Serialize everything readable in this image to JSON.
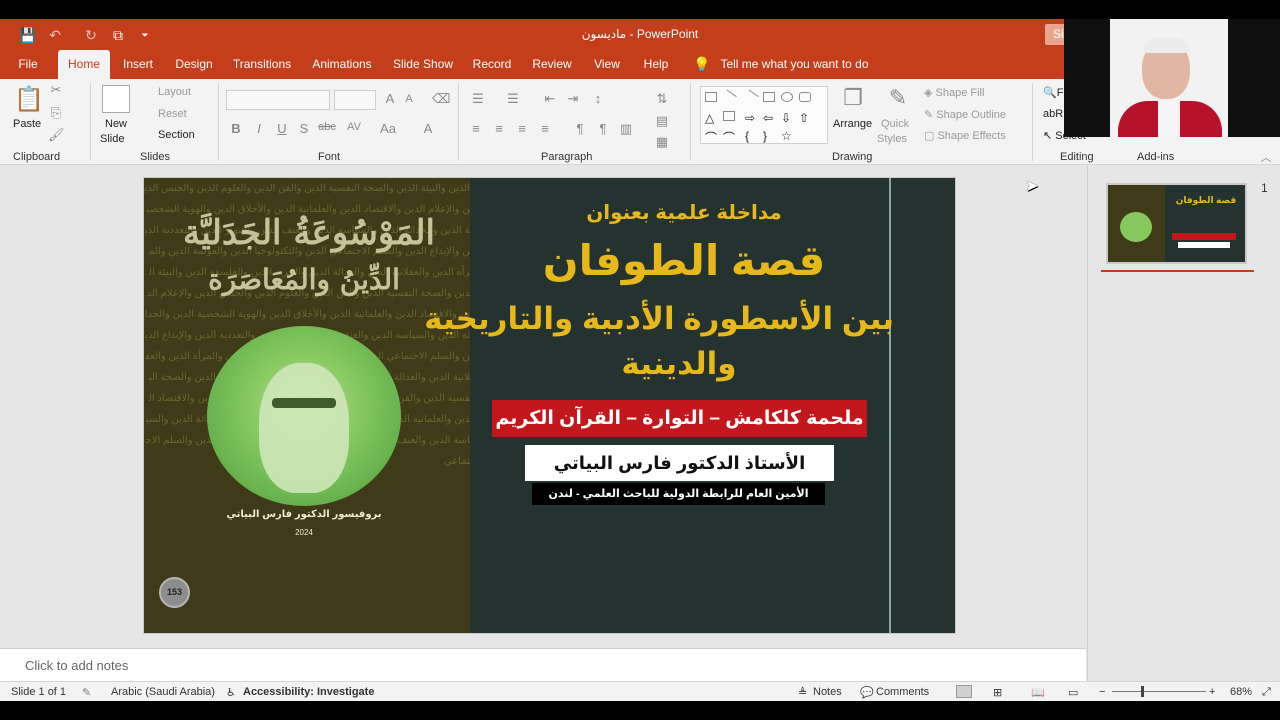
{
  "window": {
    "title": "ماديسون  -  PowerPoint",
    "signin_label": "Sig"
  },
  "qat": {
    "save": "💾",
    "undo": "↶",
    "redo": "↻",
    "present": "⧉",
    "more": "⏷"
  },
  "tabs": [
    "File",
    "Home",
    "Insert",
    "Design",
    "Transitions",
    "Animations",
    "Slide Show",
    "Record",
    "Review",
    "View",
    "Help"
  ],
  "tellme": {
    "label": "Tell me what you want to do"
  },
  "ribbon": {
    "clipboard": {
      "label": "Clipboard",
      "paste": "Paste"
    },
    "slides": {
      "label": "Slides",
      "new_slide_1": "New",
      "new_slide_2": "Slide",
      "layout": "Layout",
      "reset": "Reset",
      "section": "Section"
    },
    "font": {
      "label": "Font",
      "bold": "B",
      "italic": "I",
      "underline": "U",
      "shadow": "S",
      "strike": "abc"
    },
    "paragraph": {
      "label": "Paragraph"
    },
    "drawing": {
      "label": "Drawing",
      "arrange": "Arrange",
      "quick_styles_1": "Quick",
      "quick_styles_2": "Styles",
      "shape_fill": "Shape Fill",
      "shape_outline": "Shape Outline",
      "shape_effects": "Shape Effects"
    },
    "editing": {
      "label": "Editing",
      "find": "F",
      "replace": "R",
      "select": "Select"
    },
    "addins": {
      "label": "Add-ins"
    }
  },
  "slide": {
    "bg_text": "الدين والبيئة الدين والصحة النفسية الدين والفن الدين والعلوم الدين والجنس الدين والإعلام الدين والاقتصاد الدين والعلمانية الدين والأخلاق الدين والهوية الشخصية الدين والحداثة الدين والسياسة الدين والعنف الدين والتنوير الدين والتعددية الدين والإبداع الدين والسلم الاجتماعي الدين والتكنولوجيا الدين والعولمة الدين والمرأة الدين والعقلانية الدين والعدالة الدين والحرية الدين والفلسفة الدين والبيئة الدين والصحة النفسية الدين والفن الدين والعلوم الدين والجنس الدين والإعلام الدين والاقتصاد الدين والعلمانية الدين والأخلاق الدين والهوية الشخصية الدين والحداثة الدين والسياسة الدين والعنف الدين والتنوير الدين والتعددية الدين والإبداع الدين والسلم الاجتماعي الدين والتكنولوجيا الدين والعولمة الدين والمرأة الدين والعقلانية الدين والعدالة الدين والحرية الدين والفلسفة الدين والبيئة الدين والصحة النفسية الدين والفن الدين والعلوم الدين والجنس الدين والإعلام الدين والاقتصاد الدين والعلمانية الدين والأخلاق الدين والهوية الشخصية الدين والحداثة الدين والسياسة الدين والعنف الدين والتنوير الدين والتعددية الدين والإبداع الدين والسلم الاجتماعي",
    "book_title": "المَوْسُوعَةُ الجَدَليَّة",
    "book_subtitle": "الدِّينُ والمُعَاصَرَة",
    "author": "بروفيسور الدكتور فارس البياتي",
    "year": "2024",
    "page_badge": "153",
    "intro": "مداخلة علمية بعنوان",
    "title": "قصة الطوفان",
    "subtitle_line1": "بين الأسطورة الأدبية والتاريخية",
    "subtitle_line2": "والدينية",
    "red_banner": "ملحمة كلكامش – التوارة – القرآن الكريم",
    "presenter": "الأستاذ الدكتور فارس البياتي",
    "presenter_role": "الأمين العام للرابطة الدولية للباحث العلمي  - لندن"
  },
  "thumbnail": {
    "number": "1",
    "title": "قصة الطوفان"
  },
  "notes": {
    "placeholder": "Click to add notes"
  },
  "status": {
    "slide_info": "Slide 1 of 1",
    "language": "Arabic (Saudi Arabia)",
    "accessibility": "Accessibility: Investigate",
    "notes": "Notes",
    "comments": "Comments",
    "zoom_minus": "−",
    "zoom_plus": "+",
    "zoom": "68%"
  },
  "colors": {
    "accent": "#c43e1c",
    "title_gold": "#e7b81b",
    "banner_red": "#c2171c",
    "slide_bg": "#24332f"
  }
}
